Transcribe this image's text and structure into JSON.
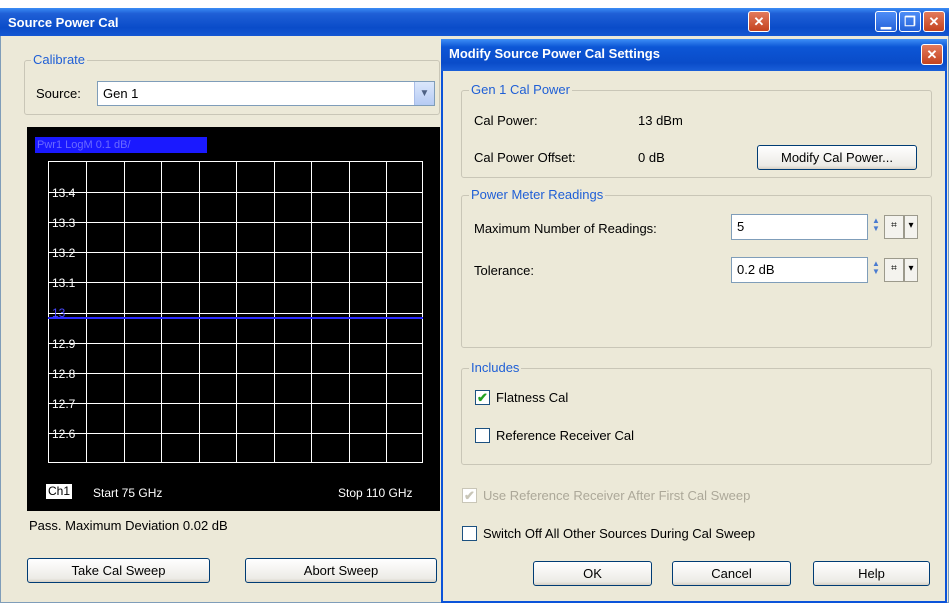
{
  "window": {
    "title": "Source Power Cal"
  },
  "calibrate": {
    "group_title": "Calibrate",
    "source_label": "Source:",
    "source_value": "Gen 1"
  },
  "plot": {
    "trace_label": "Pwr1 LogM 0.1 dB/",
    "y_ticks": [
      "13.4",
      "13.3",
      "13.2",
      "13.1",
      "13",
      "12.9",
      "12.8",
      "12.7",
      "12.6"
    ],
    "channel": "Ch1",
    "start": "Start 75 GHz",
    "stop": "Stop 110 GHz"
  },
  "status_text": "Pass. Maximum Deviation 0.02 dB",
  "buttons": {
    "take_cal_sweep": "Take Cal Sweep",
    "abort_sweep": "Abort Sweep"
  },
  "dialog": {
    "title": "Modify Source Power Cal Settings",
    "cal_power_group": "Gen 1 Cal Power",
    "cal_power_label": "Cal Power:",
    "cal_power_value": "13 dBm",
    "cal_power_offset_label": "Cal Power Offset:",
    "cal_power_offset_value": "0 dB",
    "modify_cal_power": "Modify Cal Power...",
    "readings_group": "Power Meter Readings",
    "max_readings_label": "Maximum Number of Readings:",
    "max_readings_value": "5",
    "tolerance_label": "Tolerance:",
    "tolerance_value": "0.2 dB",
    "includes_group": "Includes",
    "flatness_cal": "Flatness Cal",
    "flatness_checked": true,
    "reference_receiver_cal": "Reference Receiver Cal",
    "reference_receiver_checked": false,
    "use_ref_receiver": "Use Reference Receiver After First Cal Sweep",
    "switch_off_sources": "Switch Off All Other Sources During Cal Sweep",
    "ok": "OK",
    "cancel": "Cancel",
    "help": "Help"
  },
  "colors": {
    "titlebar": "#0a4cc9",
    "trace": "#2b2bff",
    "group_title": "#1f5fd6",
    "window_bg": "#ece9d8"
  }
}
